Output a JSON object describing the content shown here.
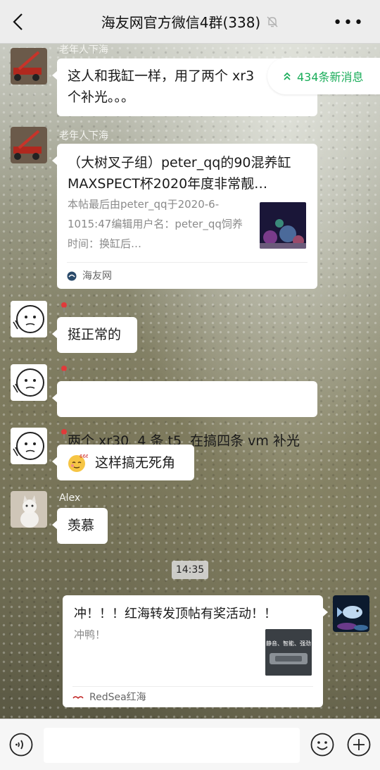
{
  "header": {
    "title": "海友网官方微信4群(338)",
    "back_icon": "chevron-left-icon",
    "mute_icon": "bell-off-icon",
    "more_label": "•••"
  },
  "new_messages": {
    "label": "434条新消息",
    "icon": "double-chevron-up-icon",
    "color": "#1aad5a"
  },
  "messages": [
    {
      "sender": "老年人下海",
      "text": "这人和我缸一样，用了两个 xr3",
      "text2": "个补光。。。"
    },
    {
      "sender": "老年人下海",
      "card": {
        "title": "（大树叉子组）peter_qq的90混养缸 MAXSPECT杯2020年度非常靓…",
        "desc": "本帖最后由peter_qq于2020-6-1015:47编辑用户名：peter_qq饲养时间：换缸后…",
        "source": "海友网"
      }
    },
    {
      "sender": "",
      "text": "挺正常的"
    },
    {
      "sender": "",
      "text": "两个 xr30  4 条 t5  在搞四条 vm 补光"
    },
    {
      "sender": "",
      "text": "这样搞无死角",
      "emoji_icon": "shy-smile-emoji-icon"
    },
    {
      "sender": "Alex",
      "text": "羡慕"
    }
  ],
  "timestamp": "14:35",
  "my_card": {
    "title": "冲！！！红海转发顶帖有奖活动！！",
    "desc": "冲鸭！",
    "thumb_text": "静音、智能、强劲",
    "source": "RedSea红海"
  },
  "input_bar": {
    "voice_icon": "voice-icon",
    "emoji_icon": "emoji-icon",
    "plus_icon": "plus-icon"
  },
  "colors": {
    "bubble": "#ffffff",
    "accent_green": "#1aad5a",
    "header_bg": "#ededed"
  }
}
